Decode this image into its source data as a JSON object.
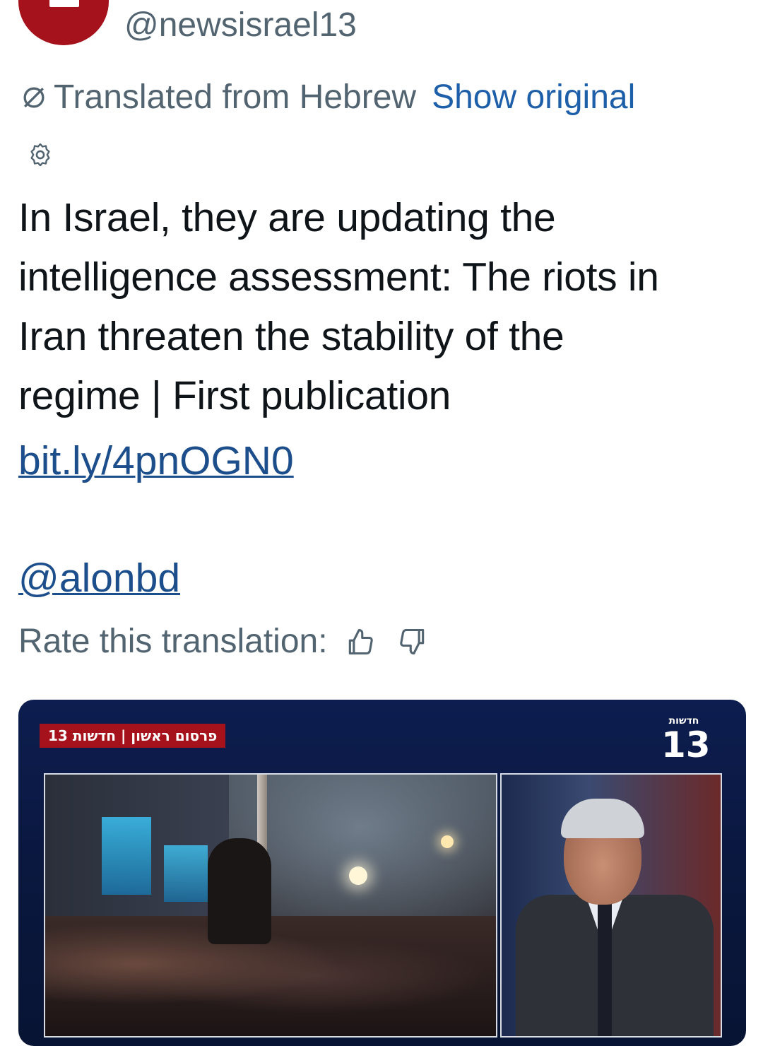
{
  "header": {
    "handle": "@newsisrael13"
  },
  "translation": {
    "from_label": "Translated from Hebrew",
    "show_original_label": "Show original"
  },
  "tweet": {
    "lines": [
      "In Israel, they are updating the",
      "intelligence assessment: The riots in",
      "Iran threaten the stability of the",
      "regime | First publication"
    ],
    "link": "bit.ly/4pnOGN0",
    "mention": "@alonbd"
  },
  "rating": {
    "label": "Rate this translation:"
  },
  "media": {
    "banner_text": "פרסום ראשון | חדשות 13",
    "channel_word": "חדשות",
    "channel_number": "13"
  },
  "icons": {
    "settings": "gear-icon",
    "translate": "translate-icon",
    "thumbs_up": "thumbs-up-icon",
    "thumbs_down": "thumbs-down-icon"
  },
  "colors": {
    "link": "#1d4e8c",
    "secondary_text": "#536471",
    "brand_red": "#a5121b",
    "media_bg": "#0d1d4f"
  }
}
